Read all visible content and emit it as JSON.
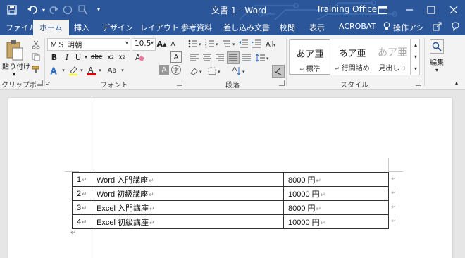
{
  "window": {
    "title": "文書 1 - Word",
    "user": "Training Office",
    "colors": {
      "titlebar": "#2b579a",
      "ribbon": "#f3f3f3",
      "canvas": "#e6e6e6"
    }
  },
  "qat": {
    "save_icon": "save-icon",
    "undo_icon": "undo-icon",
    "redo_icon": "redo-icon",
    "customize_icon": "customize-qat-icon"
  },
  "tabs": [
    {
      "label": "ファイル"
    },
    {
      "label": "ホーム"
    },
    {
      "label": "挿入"
    },
    {
      "label": "デザイン"
    },
    {
      "label": "レイアウト"
    },
    {
      "label": "参考資料"
    },
    {
      "label": "差し込み文書"
    },
    {
      "label": "校閲"
    },
    {
      "label": "表示"
    },
    {
      "label": "ACROBAT"
    },
    {
      "label": "操作アシ"
    }
  ],
  "ribbon": {
    "clipboard": {
      "paste_label": "貼り付け",
      "group_label": "クリップボード"
    },
    "font": {
      "font_name": "ＭＳ 明朝",
      "font_size": "10.5",
      "group_label": "フォント",
      "aa_label": "Aa"
    },
    "paragraph": {
      "group_label": "段落"
    },
    "styles": {
      "group_label": "スタイル",
      "items": [
        {
          "sample": "あア亜",
          "name": "標準"
        },
        {
          "sample": "あア亜",
          "name": "行間詰め"
        },
        {
          "sample": "あア亜",
          "name": "見出し 1"
        }
      ]
    },
    "editing": {
      "label": "編集"
    }
  },
  "document": {
    "table": {
      "rows": [
        {
          "num": "1",
          "name": "Word 入門講座",
          "price": "8000 円"
        },
        {
          "num": "2",
          "name": "Word 初級講座",
          "price": "10000 円"
        },
        {
          "num": "3",
          "name": "Excel 入門講座",
          "price": "8000 円"
        },
        {
          "num": "4",
          "name": "Excel 初級講座",
          "price": "10000 円"
        }
      ]
    }
  }
}
